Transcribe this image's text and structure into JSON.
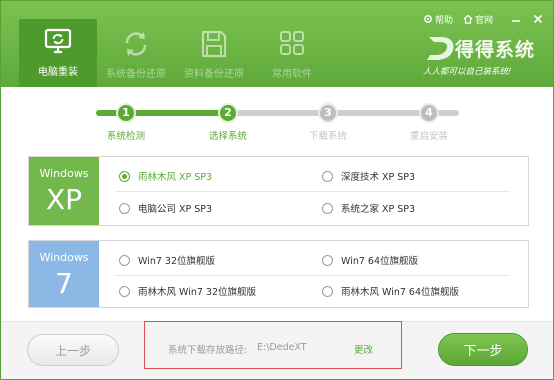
{
  "colors": {
    "accent": "#5caa36",
    "header": "#6cb446",
    "xp_badge": "#73b84c",
    "win7_badge": "#8cb8e6",
    "highlight_box": "#e05050"
  },
  "window": {
    "help_label": "帮助",
    "site_label": "官网",
    "help_icon": "gear-icon",
    "site_icon": "home-icon",
    "minimize_icon": "minimize-icon",
    "close_icon": "close-icon"
  },
  "nav": {
    "tabs": [
      {
        "label": "电脑重装",
        "icon": "monitor-refresh-icon",
        "active": true
      },
      {
        "label": "系统备份还原",
        "icon": "refresh-icon",
        "active": false
      },
      {
        "label": "资料备份还原",
        "icon": "floppy-disk-icon",
        "active": false
      },
      {
        "label": "常用软件",
        "icon": "apps-grid-icon",
        "active": false
      }
    ]
  },
  "brand": {
    "name": "得得系统",
    "slogan": "人人都可以自己装系统!",
    "logo_icon": "brand-d-logo-icon"
  },
  "steps": [
    {
      "number": "1",
      "label": "系统检测",
      "done": true
    },
    {
      "number": "2",
      "label": "选择系统",
      "done": true
    },
    {
      "number": "3",
      "label": "下载系统",
      "done": false
    },
    {
      "number": "4",
      "label": "重启安装",
      "done": false
    }
  ],
  "os_groups": {
    "xp": {
      "word": "Windows",
      "version": "XP",
      "options": [
        {
          "label": "雨林木风 XP SP3",
          "selected": true
        },
        {
          "label": "深度技术 XP SP3",
          "selected": false
        },
        {
          "label": "电脑公司 XP SP3",
          "selected": false
        },
        {
          "label": "系统之家 XP SP3",
          "selected": false
        }
      ]
    },
    "win7": {
      "word": "Windows",
      "version": "7",
      "options": [
        {
          "label": "Win7 32位旗舰版",
          "selected": false
        },
        {
          "label": "Win7 64位旗舰版",
          "selected": false
        },
        {
          "label": "雨林木风 Win7 32位旗舰版",
          "selected": false
        },
        {
          "label": "雨林木风 Win7 64位旗舰版",
          "selected": false
        }
      ]
    }
  },
  "footer": {
    "prev_label": "上一步",
    "next_label": "下一步",
    "path_label": "系统下载存放路径:",
    "path_value": "E:\\DedeXT",
    "change_label": "更改"
  }
}
